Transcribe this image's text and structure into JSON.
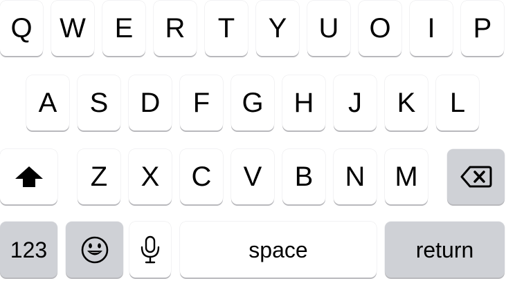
{
  "keyboard": {
    "rows": {
      "row1": [
        "Q",
        "W",
        "E",
        "R",
        "T",
        "Y",
        "U",
        "O",
        "I",
        "P"
      ],
      "row2": [
        "A",
        "S",
        "D",
        "F",
        "G",
        "H",
        "J",
        "K",
        "L"
      ],
      "row3": [
        "Z",
        "X",
        "C",
        "V",
        "B",
        "N",
        "M"
      ]
    },
    "bottom": {
      "numbers_label": "123",
      "space_label": "space",
      "return_label": "return"
    },
    "icons": {
      "shift": "shift-arrow-icon",
      "delete": "backspace-icon",
      "emoji": "emoji-icon",
      "dictation": "microphone-icon"
    },
    "colors": {
      "key_background": "#ffffff",
      "special_key_background": "#cfd1d6",
      "text": "#000000"
    }
  }
}
